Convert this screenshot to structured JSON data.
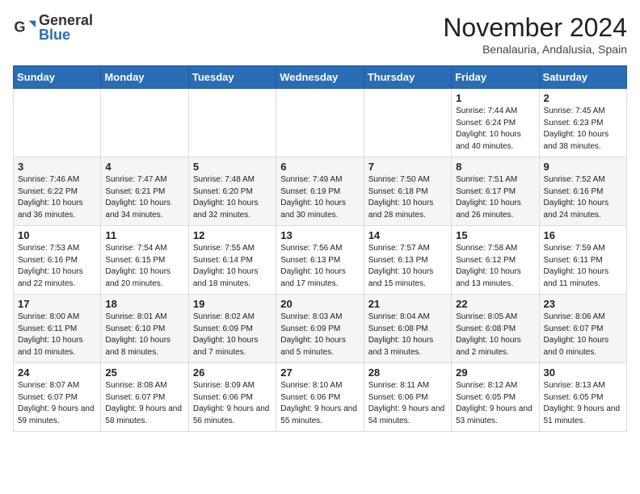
{
  "header": {
    "logo_general": "General",
    "logo_blue": "Blue",
    "month_title": "November 2024",
    "location": "Benalauria, Andalusia, Spain"
  },
  "calendar": {
    "days_of_week": [
      "Sunday",
      "Monday",
      "Tuesday",
      "Wednesday",
      "Thursday",
      "Friday",
      "Saturday"
    ],
    "weeks": [
      [
        {
          "day": "",
          "info": ""
        },
        {
          "day": "",
          "info": ""
        },
        {
          "day": "",
          "info": ""
        },
        {
          "day": "",
          "info": ""
        },
        {
          "day": "",
          "info": ""
        },
        {
          "day": "1",
          "info": "Sunrise: 7:44 AM\nSunset: 6:24 PM\nDaylight: 10 hours and 40 minutes."
        },
        {
          "day": "2",
          "info": "Sunrise: 7:45 AM\nSunset: 6:23 PM\nDaylight: 10 hours and 38 minutes."
        }
      ],
      [
        {
          "day": "3",
          "info": "Sunrise: 7:46 AM\nSunset: 6:22 PM\nDaylight: 10 hours and 36 minutes."
        },
        {
          "day": "4",
          "info": "Sunrise: 7:47 AM\nSunset: 6:21 PM\nDaylight: 10 hours and 34 minutes."
        },
        {
          "day": "5",
          "info": "Sunrise: 7:48 AM\nSunset: 6:20 PM\nDaylight: 10 hours and 32 minutes."
        },
        {
          "day": "6",
          "info": "Sunrise: 7:49 AM\nSunset: 6:19 PM\nDaylight: 10 hours and 30 minutes."
        },
        {
          "day": "7",
          "info": "Sunrise: 7:50 AM\nSunset: 6:18 PM\nDaylight: 10 hours and 28 minutes."
        },
        {
          "day": "8",
          "info": "Sunrise: 7:51 AM\nSunset: 6:17 PM\nDaylight: 10 hours and 26 minutes."
        },
        {
          "day": "9",
          "info": "Sunrise: 7:52 AM\nSunset: 6:16 PM\nDaylight: 10 hours and 24 minutes."
        }
      ],
      [
        {
          "day": "10",
          "info": "Sunrise: 7:53 AM\nSunset: 6:16 PM\nDaylight: 10 hours and 22 minutes."
        },
        {
          "day": "11",
          "info": "Sunrise: 7:54 AM\nSunset: 6:15 PM\nDaylight: 10 hours and 20 minutes."
        },
        {
          "day": "12",
          "info": "Sunrise: 7:55 AM\nSunset: 6:14 PM\nDaylight: 10 hours and 18 minutes."
        },
        {
          "day": "13",
          "info": "Sunrise: 7:56 AM\nSunset: 6:13 PM\nDaylight: 10 hours and 17 minutes."
        },
        {
          "day": "14",
          "info": "Sunrise: 7:57 AM\nSunset: 6:13 PM\nDaylight: 10 hours and 15 minutes."
        },
        {
          "day": "15",
          "info": "Sunrise: 7:58 AM\nSunset: 6:12 PM\nDaylight: 10 hours and 13 minutes."
        },
        {
          "day": "16",
          "info": "Sunrise: 7:59 AM\nSunset: 6:11 PM\nDaylight: 10 hours and 11 minutes."
        }
      ],
      [
        {
          "day": "17",
          "info": "Sunrise: 8:00 AM\nSunset: 6:11 PM\nDaylight: 10 hours and 10 minutes."
        },
        {
          "day": "18",
          "info": "Sunrise: 8:01 AM\nSunset: 6:10 PM\nDaylight: 10 hours and 8 minutes."
        },
        {
          "day": "19",
          "info": "Sunrise: 8:02 AM\nSunset: 6:09 PM\nDaylight: 10 hours and 7 minutes."
        },
        {
          "day": "20",
          "info": "Sunrise: 8:03 AM\nSunset: 6:09 PM\nDaylight: 10 hours and 5 minutes."
        },
        {
          "day": "21",
          "info": "Sunrise: 8:04 AM\nSunset: 6:08 PM\nDaylight: 10 hours and 3 minutes."
        },
        {
          "day": "22",
          "info": "Sunrise: 8:05 AM\nSunset: 6:08 PM\nDaylight: 10 hours and 2 minutes."
        },
        {
          "day": "23",
          "info": "Sunrise: 8:06 AM\nSunset: 6:07 PM\nDaylight: 10 hours and 0 minutes."
        }
      ],
      [
        {
          "day": "24",
          "info": "Sunrise: 8:07 AM\nSunset: 6:07 PM\nDaylight: 9 hours and 59 minutes."
        },
        {
          "day": "25",
          "info": "Sunrise: 8:08 AM\nSunset: 6:07 PM\nDaylight: 9 hours and 58 minutes."
        },
        {
          "day": "26",
          "info": "Sunrise: 8:09 AM\nSunset: 6:06 PM\nDaylight: 9 hours and 56 minutes."
        },
        {
          "day": "27",
          "info": "Sunrise: 8:10 AM\nSunset: 6:06 PM\nDaylight: 9 hours and 55 minutes."
        },
        {
          "day": "28",
          "info": "Sunrise: 8:11 AM\nSunset: 6:06 PM\nDaylight: 9 hours and 54 minutes."
        },
        {
          "day": "29",
          "info": "Sunrise: 8:12 AM\nSunset: 6:05 PM\nDaylight: 9 hours and 53 minutes."
        },
        {
          "day": "30",
          "info": "Sunrise: 8:13 AM\nSunset: 6:05 PM\nDaylight: 9 hours and 51 minutes."
        }
      ]
    ]
  }
}
